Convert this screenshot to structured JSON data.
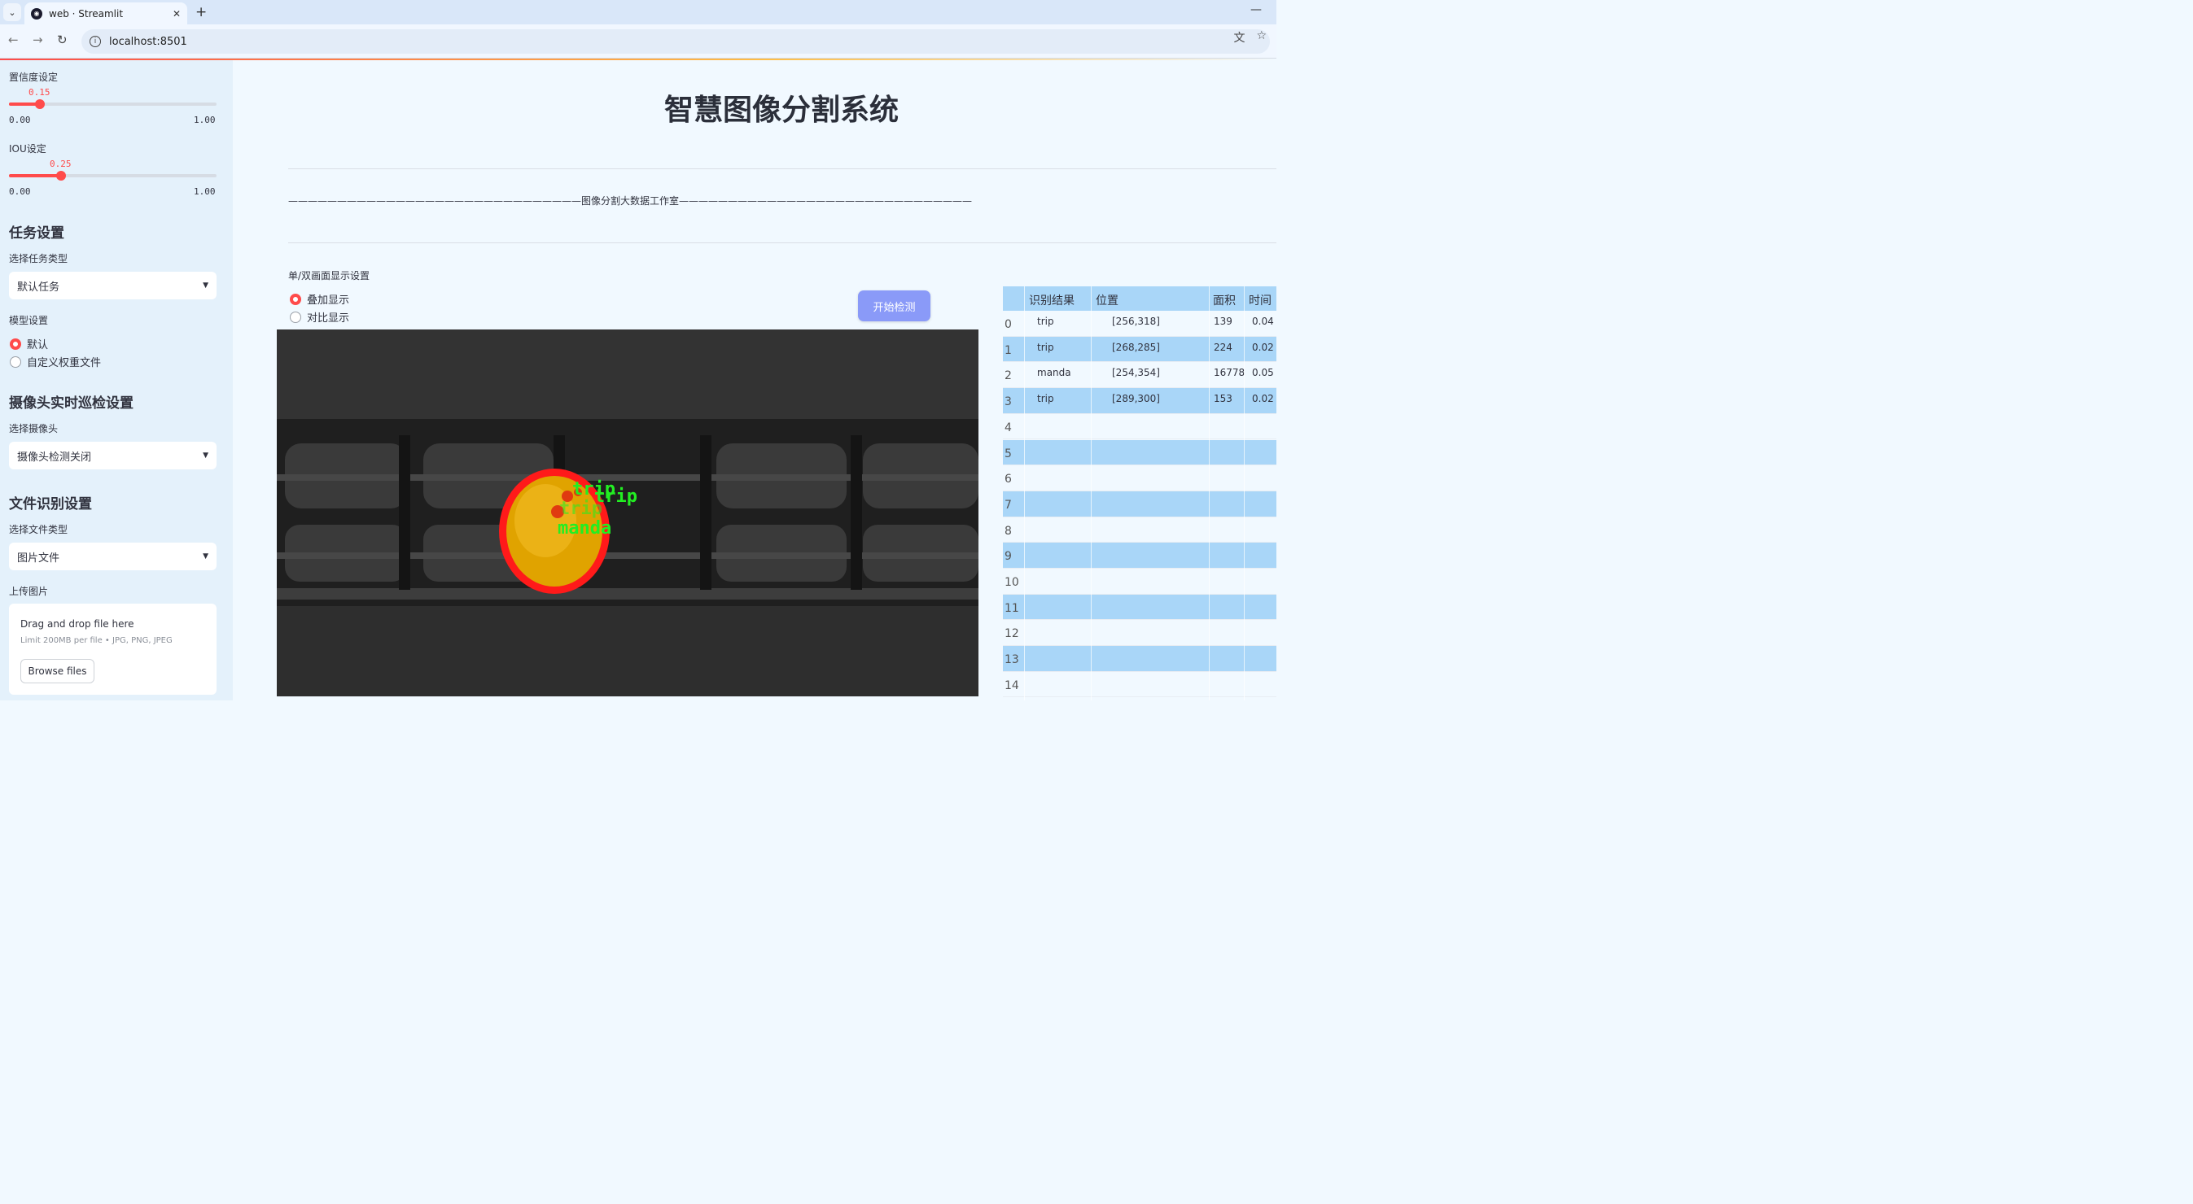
{
  "browser": {
    "tab_title": "web · Streamlit",
    "url": "localhost:8501"
  },
  "sidebar": {
    "confidence": {
      "label": "置信度设定",
      "value": "0.15",
      "min": "0.00",
      "max": "1.00",
      "fraction": 0.15
    },
    "iou": {
      "label": "IOU设定",
      "value": "0.25",
      "min": "0.00",
      "max": "1.00",
      "fraction": 0.25
    },
    "task_header": "任务设置",
    "task_type_label": "选择任务类型",
    "task_type_value": "默认任务",
    "model_label": "模型设置",
    "model_options": [
      "默认",
      "自定义权重文件"
    ],
    "model_selected": 0,
    "camera_header": "摄像头实时巡检设置",
    "camera_label": "选择摄像头",
    "camera_value": "摄像头检测关闭",
    "file_header": "文件识别设置",
    "file_type_label": "选择文件类型",
    "file_type_value": "图片文件",
    "upload_label": "上传图片",
    "upload_title": "Drag and drop file here",
    "upload_limit": "Limit 200MB per file • JPG, PNG, JPEG",
    "browse_label": "Browse files"
  },
  "main": {
    "title": "智慧图像分割系统",
    "divider_text": "——————————————————————————————图像分割大数据工作室——————————————————————————————",
    "display_label": "单/双画面显示设置",
    "display_options": [
      "叠加显示",
      "对比显示"
    ],
    "display_selected": 0,
    "start_button": "开始检测",
    "detections": [
      "trip",
      "trip",
      "trip",
      "manda"
    ]
  },
  "table": {
    "headers": [
      "识别结果",
      "位置",
      "面积",
      "时间"
    ],
    "rows": [
      {
        "idx": "0",
        "label": "trip",
        "pos": "[256,318]",
        "area": "139",
        "time": "0.04"
      },
      {
        "idx": "1",
        "label": "trip",
        "pos": "[268,285]",
        "area": "224",
        "time": "0.02"
      },
      {
        "idx": "2",
        "label": "manda",
        "pos": "[254,354]",
        "area": "16778",
        "time": "0.05"
      },
      {
        "idx": "3",
        "label": "trip",
        "pos": "[289,300]",
        "area": "153",
        "time": "0.02"
      },
      {
        "idx": "4",
        "label": "",
        "pos": "",
        "area": "",
        "time": ""
      },
      {
        "idx": "5",
        "label": "",
        "pos": "",
        "area": "",
        "time": ""
      },
      {
        "idx": "6",
        "label": "",
        "pos": "",
        "area": "",
        "time": ""
      },
      {
        "idx": "7",
        "label": "",
        "pos": "",
        "area": "",
        "time": ""
      },
      {
        "idx": "8",
        "label": "",
        "pos": "",
        "area": "",
        "time": ""
      },
      {
        "idx": "9",
        "label": "",
        "pos": "",
        "area": "",
        "time": ""
      },
      {
        "idx": "10",
        "label": "",
        "pos": "",
        "area": "",
        "time": ""
      },
      {
        "idx": "11",
        "label": "",
        "pos": "",
        "area": "",
        "time": ""
      },
      {
        "idx": "12",
        "label": "",
        "pos": "",
        "area": "",
        "time": ""
      },
      {
        "idx": "13",
        "label": "",
        "pos": "",
        "area": "",
        "time": ""
      },
      {
        "idx": "14",
        "label": "",
        "pos": "",
        "area": "",
        "time": ""
      }
    ]
  },
  "colors": {
    "accent": "#ff4b4b",
    "button": "#8a9af8",
    "table_header": "#a9d6f8",
    "mask": "#ff1a1a",
    "label_text": "#22ee22"
  }
}
